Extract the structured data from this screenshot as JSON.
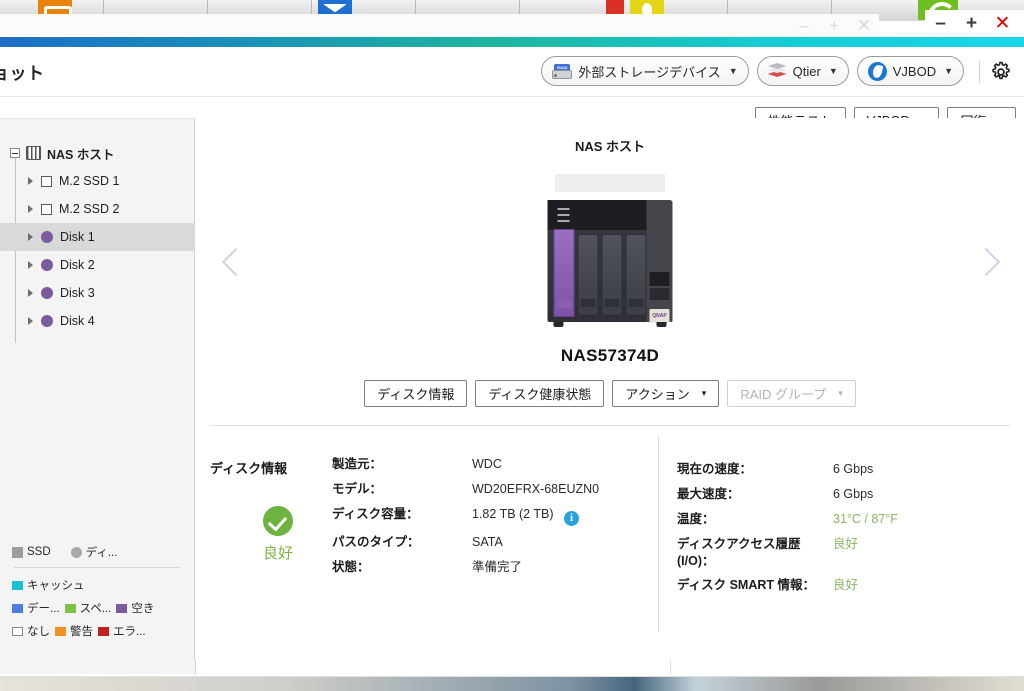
{
  "window": {
    "controls": {
      "minimize": "–",
      "maximize": "+",
      "close": "✕"
    },
    "bg_controls": {
      "minimize": "–",
      "maximize": "+",
      "close": "✕"
    }
  },
  "header": {
    "title": "ョット",
    "external_storage_label": "外部ストレージデバイス",
    "qtier_label": "Qtier",
    "vjbod_label": "VJBOD",
    "caret": "▼",
    "gear_icon": "gear-icon",
    "raid_badge": "RAID"
  },
  "toolbar": {
    "perf_test_label": "性能テスト",
    "vjbod_label": "VJBOD",
    "recover_label": "回復",
    "caret": "▾"
  },
  "sidebar": {
    "root": {
      "label": "NAS ホスト",
      "expander": "−"
    },
    "items": [
      {
        "label": "M.2 SSD 1",
        "icon": "ssd-square-icon",
        "selected": false
      },
      {
        "label": "M.2 SSD 2",
        "icon": "ssd-square-icon",
        "selected": false
      },
      {
        "label": "Disk 1",
        "icon": "disk-circle-icon",
        "selected": true
      },
      {
        "label": "Disk 2",
        "icon": "disk-circle-icon",
        "selected": false
      },
      {
        "label": "Disk 3",
        "icon": "disk-circle-icon",
        "selected": false
      },
      {
        "label": "Disk 4",
        "icon": "disk-circle-icon",
        "selected": false
      }
    ],
    "legend": {
      "row1": [
        {
          "label": "SSD",
          "color": "#9d9d9d",
          "shape": "square"
        },
        {
          "label": "ディ...",
          "color": "#a8a8a8",
          "shape": "circle"
        }
      ],
      "row2": [
        {
          "label": "キャッシュ",
          "color": "#1bbfd4",
          "shape": "square"
        }
      ],
      "row3": [
        {
          "label": "デー...",
          "color": "#4a7ee0",
          "shape": "square"
        },
        {
          "label": "スペ...",
          "color": "#7bc142",
          "shape": "square"
        },
        {
          "label": "空き",
          "color": "#7b5aa0",
          "shape": "square"
        }
      ],
      "row4": [
        {
          "label": "なし",
          "color": "#ffffff",
          "shape": "hollow"
        },
        {
          "label": "警告",
          "color": "#f29024",
          "shape": "square"
        },
        {
          "label": "エラ...",
          "color": "#c31f1f",
          "shape": "square"
        }
      ]
    }
  },
  "device": {
    "title": "NAS ホスト",
    "model": "NAS57374D",
    "nas_logo_text": "QNAP",
    "prev_arrow": "prev-arrow",
    "next_arrow": "next-arrow"
  },
  "tabs": [
    {
      "label": "ディスク情報",
      "disabled": false
    },
    {
      "label": "ディスク健康状態",
      "disabled": false
    },
    {
      "label": "アクション",
      "disabled": false,
      "caret": "▾"
    },
    {
      "label": "RAID グループ",
      "disabled": true,
      "caret": "▾"
    }
  ],
  "disk_info": {
    "heading": "ディスク情報",
    "health_status": "良好",
    "health_icon": "check-circle-icon",
    "left_rows": [
      {
        "key": "製造元：",
        "value": "WDC"
      },
      {
        "key": "モデル：",
        "value": "WD20EFRX-68EUZN0"
      },
      {
        "key": "ディスク容量：",
        "value": "1.82 TB (2 TB)",
        "info_icon": "i"
      },
      {
        "key": "パスのタイプ：",
        "value": "SATA"
      },
      {
        "key": "状態：",
        "value": "準備完了"
      }
    ],
    "right_rows": [
      {
        "key": "現在の速度：",
        "value": "6 Gbps",
        "green": false
      },
      {
        "key": "最大速度：",
        "value": "6 Gbps",
        "green": false
      },
      {
        "key": "温度：",
        "value": "31°C / 87°F",
        "green": true
      },
      {
        "key": "ディスクアクセス履歴 (I/O)：",
        "value": "良好",
        "green": true
      },
      {
        "key": "ディスク SMART 情報：",
        "value": "良好",
        "green": true
      }
    ]
  },
  "colors": {
    "accent_start": "#1f6ec6",
    "accent_end": "#18d6e8",
    "selected_row": "#d9d9d9",
    "health_green": "#7fb341",
    "disk_purple": "#7b5aa0",
    "info_blue": "#29a3e0"
  }
}
